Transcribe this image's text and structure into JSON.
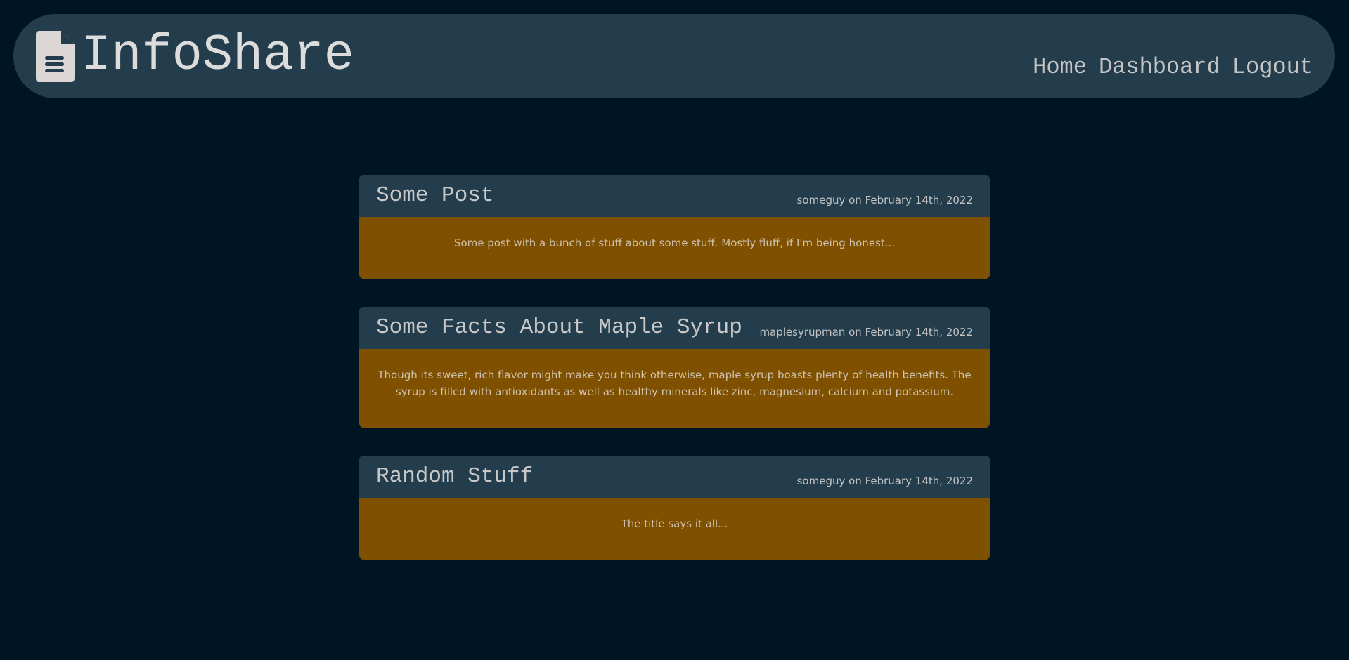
{
  "app": {
    "title": "InfoShare",
    "logo_icon": "document-icon"
  },
  "nav": {
    "home": "Home",
    "dashboard": "Dashboard",
    "logout": "Logout"
  },
  "posts": [
    {
      "title": "Some Post",
      "meta": "someguy on February 14th, 2022",
      "body": "Some post with a bunch of stuff about some stuff. Mostly fluff, if I'm being honest..."
    },
    {
      "title": "Some Facts About Maple Syrup",
      "meta": "maplesyrupman on February 14th, 2022",
      "body": "Though its sweet, rich flavor might make you think otherwise, maple syrup boasts plenty of health benefits. The syrup is filled with antioxidants as well as healthy minerals like zinc, magnesium, calcium and potassium."
    },
    {
      "title": "Random Stuff",
      "meta": "someguy on February 14th, 2022",
      "body": "The title says it all..."
    }
  ],
  "colors": {
    "background": "#001524",
    "panel": "#233d4d",
    "post_body": "#7e5000",
    "text_light": "#dcdcdc"
  }
}
